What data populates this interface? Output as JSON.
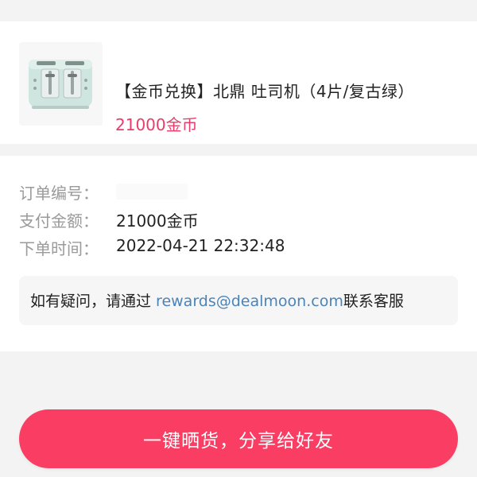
{
  "product": {
    "title": "【金币兑换】北鼎 吐司机（4片/复古绿）",
    "price": "21000金币",
    "image_alt": "toaster-image"
  },
  "order": {
    "number_label": "订单编号：",
    "number_value": "",
    "amount_label": "支付金额：",
    "amount_value": "21000金币",
    "time_label": "下单时间：",
    "time_value": "2022-04-21 22:32:48"
  },
  "help": {
    "prefix": "如有疑问，请通过 ",
    "email": "rewards@dealmoon.com",
    "suffix": "联系客服"
  },
  "share_button": {
    "label": "一键晒货，分享给好友"
  },
  "colors": {
    "accent": "#fa3d63",
    "price": "#e83d6b",
    "link": "#4a84b8"
  }
}
